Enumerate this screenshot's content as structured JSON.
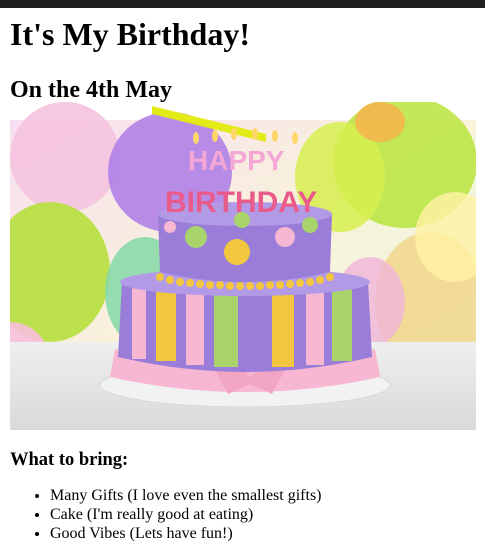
{
  "page": {
    "title": "It's My Birthday!",
    "subtitle": "On the 4th May",
    "hero_image": {
      "icon": "birthday-cake-image",
      "candle_text": "HAPPY BIRTHDAY",
      "colors": {
        "cake_purple": "#9a7dd9",
        "cake_yellow": "#f2c73f",
        "cake_pink": "#f7b7d2",
        "cake_green": "#a9d46b"
      }
    },
    "bring_heading": "What to bring:",
    "bring_items": [
      "Many Gifts (I love even the smallest gifts)",
      "Cake (I'm really good at eating)",
      "Good Vibes (Lets have fun!)"
    ]
  }
}
